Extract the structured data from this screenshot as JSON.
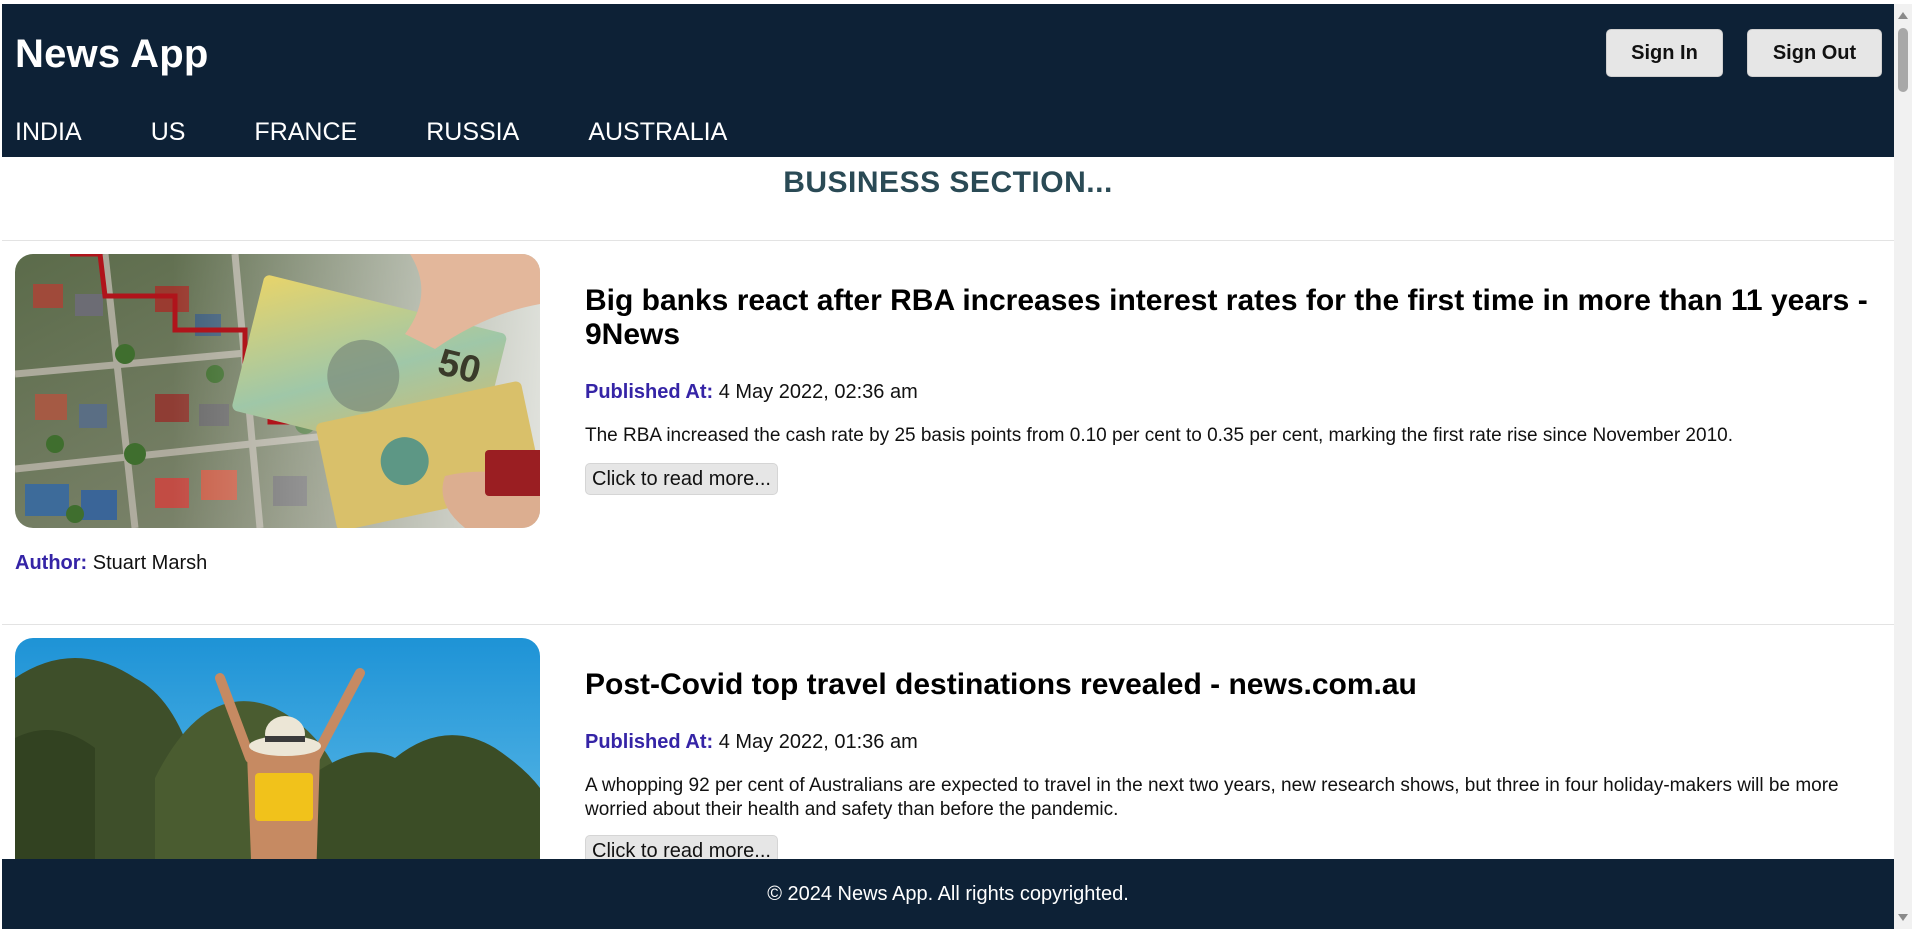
{
  "app": {
    "title": "News App"
  },
  "auth": {
    "sign_in": "Sign In",
    "sign_out": "Sign Out"
  },
  "nav": {
    "items": [
      "INDIA",
      "US",
      "FRANCE",
      "RUSSIA",
      "AUSTRALIA"
    ]
  },
  "section": {
    "title": "BUSINESS SECTION..."
  },
  "labels": {
    "published": "Published At:",
    "author": "Author:",
    "read_more": "Click to read more..."
  },
  "articles": [
    {
      "title": "Big banks react after RBA increases interest rates for the first time in more than 11 years - 9News",
      "published_at": "4 May 2022, 02:36 am",
      "description": "The RBA increased the cash rate by 25 basis points from 0.10 per cent to 0.35 per cent, marking the first rate rise since November 2010.",
      "author": "Stuart Marsh",
      "image": "banknotes-over-suburb-photo"
    },
    {
      "title": "Post-Covid top travel destinations revealed - news.com.au",
      "published_at": "4 May 2022, 01:36 am",
      "description": "A whopping 92 per cent of Australians are expected to travel in the next two years, new research shows, but three in four holiday-makers will be more worried about their health and safety than before the pandemic.",
      "image": "beach-traveller-photo"
    }
  ],
  "footer": {
    "text": "© 2024 News App. All rights copyrighted."
  },
  "colors": {
    "header_bg": "#0d2136",
    "label": "#3524a6",
    "section_title": "#2a4a55"
  }
}
